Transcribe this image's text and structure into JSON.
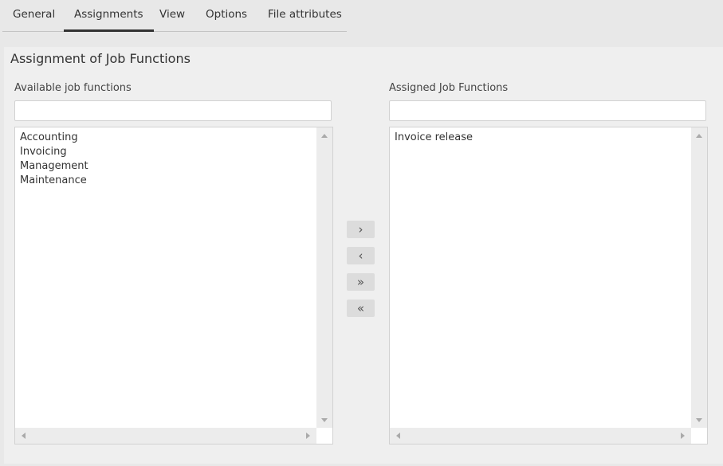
{
  "tabs": [
    {
      "label": "General"
    },
    {
      "label": "Assignments"
    },
    {
      "label": "View"
    },
    {
      "label": "Options"
    },
    {
      "label": "File attributes"
    }
  ],
  "panel": {
    "title": "Assignment of Job Functions",
    "available": {
      "label": "Available job functions",
      "filter_value": "",
      "items": [
        "Accounting",
        "Invoicing",
        "Management",
        "Maintenance"
      ]
    },
    "assigned": {
      "label": "Assigned Job Functions",
      "filter_value": "",
      "items": [
        "Invoice release"
      ]
    },
    "move_buttons": {
      "add": "›",
      "remove": "‹",
      "add_all": "»",
      "remove_all": "«"
    }
  }
}
